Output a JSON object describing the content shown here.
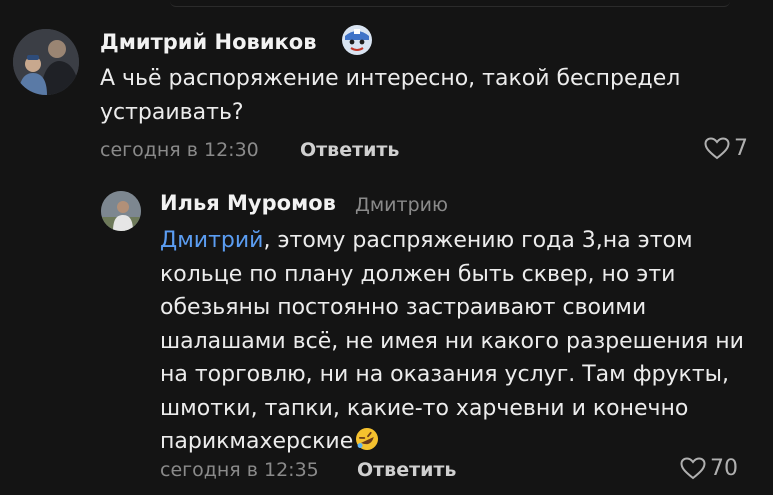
{
  "comment": {
    "author": "Дмитрий Новиков",
    "text": "А чьё распоряжение интересно, такой беспредел устраивать?",
    "time": "сегодня в 12:30",
    "reply_label": "Ответить",
    "likes": "7"
  },
  "reply": {
    "author": "Илья Муромов",
    "addressee": "Дмитрию",
    "mention": "Дмитрий",
    "text": ", этому распряжению года 3,на этом кольце по плану должен быть сквер, но эти обезьяны постоянно застраивают своими шалашами всё, не имея ни какого  разрешения ни на торговлю, ни на оказания услуг. Там фрукты, шмотки, тапки, какие-то харчевни и конечно парикмахерские",
    "time": "сегодня в 12:35",
    "reply_label": "Ответить",
    "likes": "70"
  },
  "icons": {
    "heart": "heart-outline-icon",
    "badge": "captain-shield-badge-icon",
    "emoji": "rofl-emoji-icon"
  },
  "colors": {
    "background": "#141414",
    "mention": "#5b9df2"
  }
}
